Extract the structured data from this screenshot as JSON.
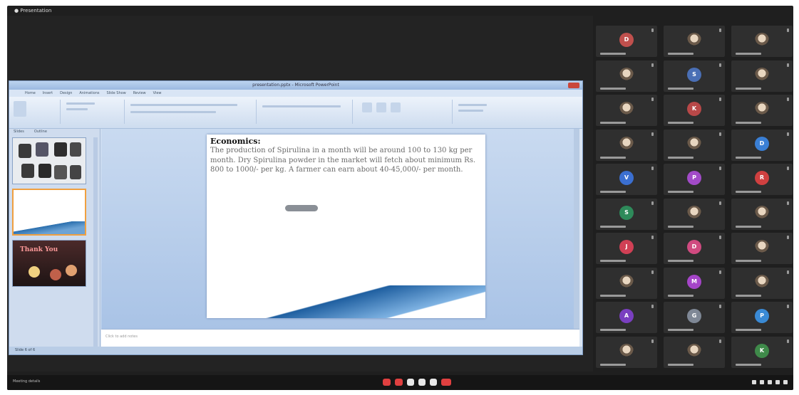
{
  "meeting": {
    "title_bar": "● Presentation",
    "bottom_label": "Meeting details",
    "controls": [
      "mic-button",
      "camera-button",
      "captions-button",
      "hand-button",
      "present-button",
      "end-call-button"
    ]
  },
  "ppt": {
    "window_title": "presentation.pptx - Microsoft PowerPoint",
    "tabs": [
      "Home",
      "Insert",
      "Design",
      "Animations",
      "Slide Show",
      "Review",
      "View"
    ],
    "pane_tabs": [
      "Slides",
      "Outline"
    ],
    "notes_placeholder": "Click to add notes",
    "status": "Slide 6 of 6"
  },
  "slide": {
    "title": "Economics:",
    "body": "The production of Spirulina in a month will be around 100 to 130 kg per month. Dry Spirulina powder in the market will fetch about minimum Rs. 800 to 1000/- per kg. A farmer can earn about 40-45,000/- per month."
  },
  "thumbnails": [
    {
      "name": "slide-thumb-images"
    },
    {
      "name": "slide-thumb-current"
    },
    {
      "name": "slide-thumb-thank-you",
      "text": "Thank You"
    }
  ],
  "participants": [
    {
      "initial": "D",
      "color": "#c0504d"
    },
    {
      "initial": "",
      "color": "#6b6b6b",
      "photo": true
    },
    {
      "initial": "",
      "color": "#6b6b6b",
      "photo": true
    },
    {
      "initial": "",
      "color": "#b9a020",
      "photo": true
    },
    {
      "initial": "S",
      "color": "#4a6fb5"
    },
    {
      "initial": "",
      "color": "#6b6b6b",
      "photo": true
    },
    {
      "initial": "",
      "color": "#c84040",
      "photo": true
    },
    {
      "initial": "K",
      "color": "#b84848"
    },
    {
      "initial": "",
      "color": "#6b6b6b",
      "photo": true
    },
    {
      "initial": "",
      "color": "#dddddd",
      "photo": true
    },
    {
      "initial": "",
      "color": "#dddddd",
      "photo": true
    },
    {
      "initial": "D",
      "color": "#3a7fd5"
    },
    {
      "initial": "V",
      "color": "#3b6fd0"
    },
    {
      "initial": "P",
      "color": "#a24bc8"
    },
    {
      "initial": "R",
      "color": "#d04040"
    },
    {
      "initial": "S",
      "color": "#2e8a5a"
    },
    {
      "initial": "",
      "color": "#6b6b6b",
      "photo": true
    },
    {
      "initial": "",
      "color": "#dddddd",
      "photo": true
    },
    {
      "initial": "J",
      "color": "#d04055"
    },
    {
      "initial": "D",
      "color": "#d04a80"
    },
    {
      "initial": "",
      "color": "#6b6b6b",
      "photo": true
    },
    {
      "initial": "",
      "color": "#dddddd",
      "photo": true
    },
    {
      "initial": "M",
      "color": "#a545c8"
    },
    {
      "initial": "",
      "color": "#dddddd",
      "photo": true
    },
    {
      "initial": "A",
      "color": "#7a3fc0"
    },
    {
      "initial": "G",
      "color": "#7f8896"
    },
    {
      "initial": "P",
      "color": "#3a8ad5"
    },
    {
      "initial": "",
      "color": "#6b6b6b",
      "photo": true
    },
    {
      "initial": "",
      "color": "#6b6b6b",
      "photo": true
    },
    {
      "initial": "K",
      "color": "#3f8a4a"
    }
  ]
}
